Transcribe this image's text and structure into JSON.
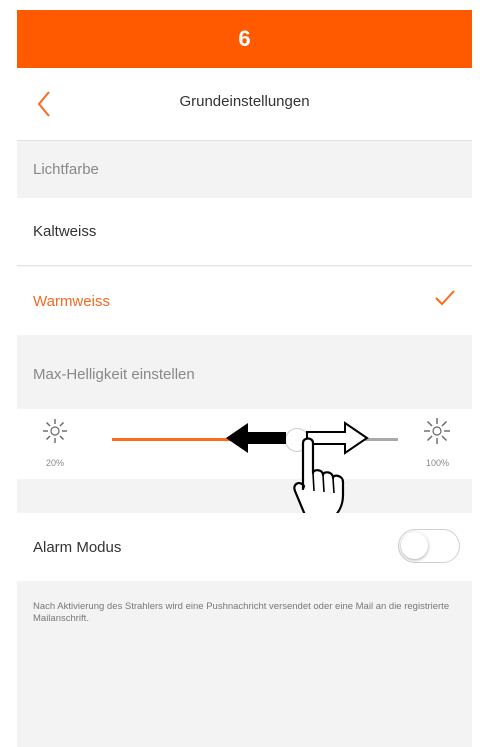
{
  "step": {
    "number": "6"
  },
  "header": {
    "title": "Grundeinstellungen"
  },
  "sections": {
    "light_color": "Lichtfarbe",
    "brightness": "Max-Helligkeit einstellen"
  },
  "color_options": [
    {
      "label": "Kaltweiss",
      "selected": false
    },
    {
      "label": "Warmweiss",
      "selected": true
    }
  ],
  "brightness": {
    "min_label": "20%",
    "max_label": "100%",
    "value_fraction": 0.62
  },
  "alarm": {
    "label": "Alarm Modus",
    "enabled": false
  },
  "info_text": "Nach Aktivierung des Strahlers wird eine Pushnachricht versendet oder eine Mail an die registrierte Mailanschrift.",
  "colors": {
    "accent": "#ff5a00",
    "selected_text": "#f26a21",
    "background": "#f3f3f3"
  }
}
